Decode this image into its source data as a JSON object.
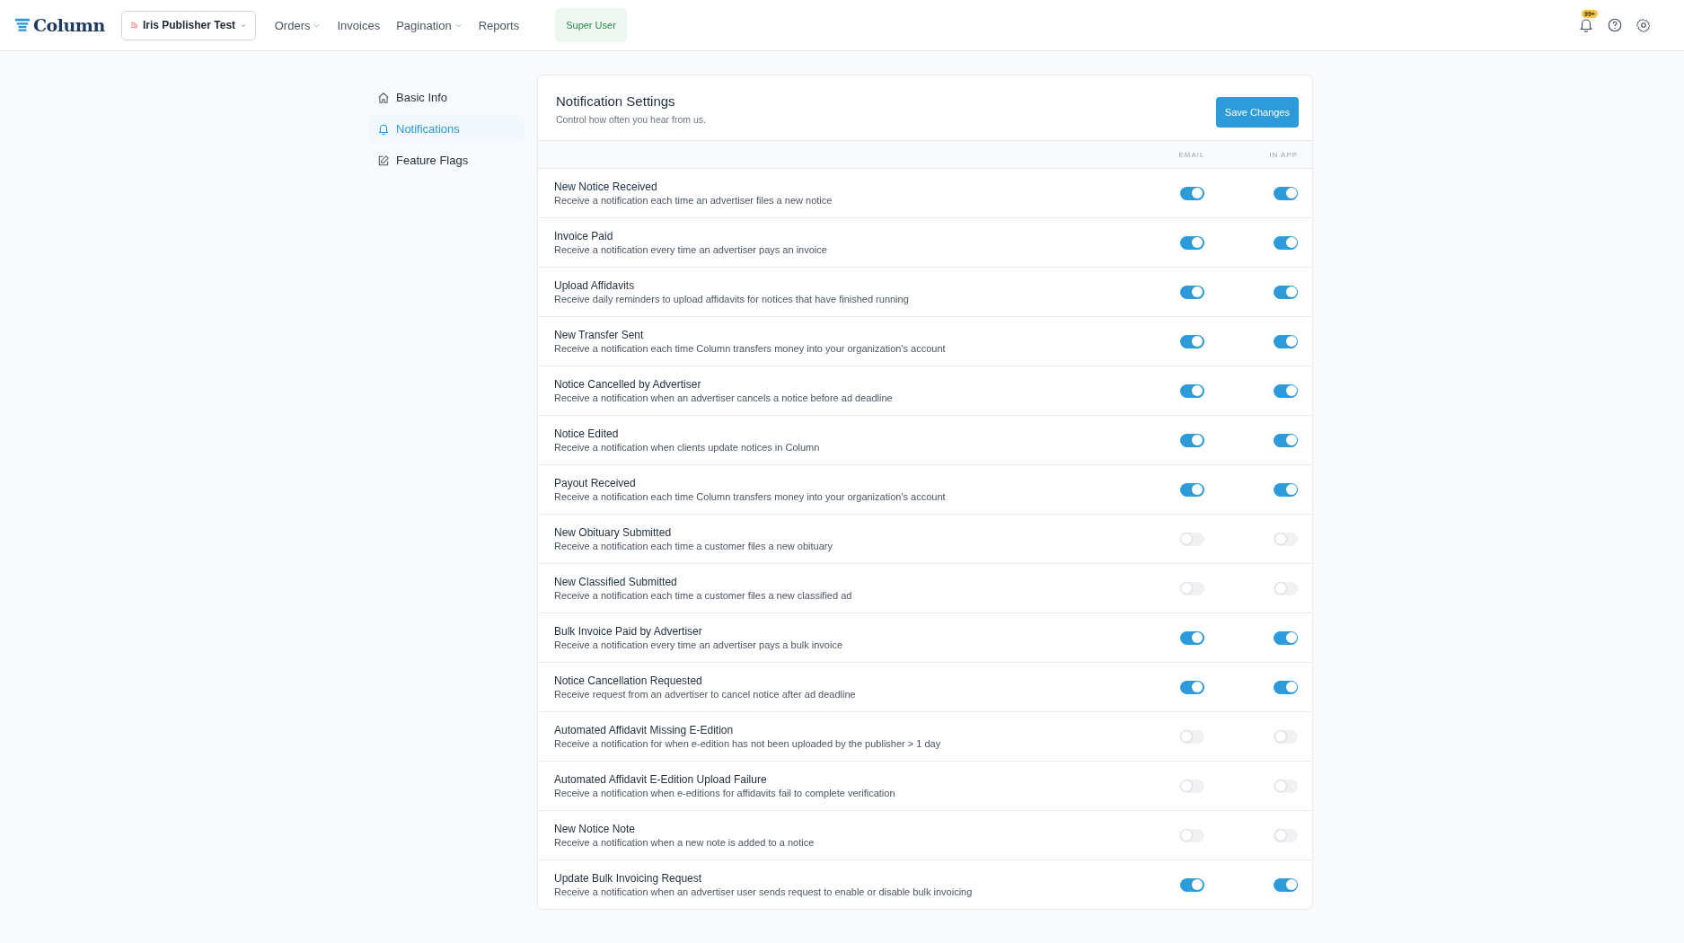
{
  "nav": {
    "logo": "Column",
    "publisher": "Iris Publisher Test",
    "menu": [
      {
        "label": "Orders",
        "dropdown": true
      },
      {
        "label": "Invoices",
        "dropdown": false
      },
      {
        "label": "Pagination",
        "dropdown": true
      },
      {
        "label": "Reports",
        "dropdown": false
      }
    ],
    "role_badge": "Super User",
    "notification_count": "99+"
  },
  "sidebar": {
    "items": [
      {
        "label": "Basic Info",
        "kind": "home",
        "selected": false
      },
      {
        "label": "Notifications",
        "kind": "bell",
        "selected": true
      },
      {
        "label": "Feature Flags",
        "kind": "edit",
        "selected": false
      }
    ]
  },
  "panel": {
    "title": "Notification Settings",
    "subtitle": "Control how often you hear from us.",
    "save_button": "Save Changes",
    "columns": [
      "EMAIL",
      "IN APP"
    ],
    "rows": [
      {
        "title": "New Notice Received",
        "description": "Receive a notification each time an advertiser files a new notice",
        "email": true,
        "in_app": true
      },
      {
        "title": "Invoice Paid",
        "description": "Receive a notification every time an advertiser pays an invoice",
        "email": true,
        "in_app": true
      },
      {
        "title": "Upload Affidavits",
        "description": "Receive daily reminders to upload affidavits for notices that have finished running",
        "email": true,
        "in_app": true
      },
      {
        "title": "New Transfer Sent",
        "description": "Receive a notification each time Column transfers money into your organization's account",
        "email": true,
        "in_app": true
      },
      {
        "title": "Notice Cancelled by Advertiser",
        "description": "Receive a notification when an advertiser cancels a notice before ad deadline",
        "email": true,
        "in_app": true
      },
      {
        "title": "Notice Edited",
        "description": "Receive a notification when clients update notices in Column",
        "email": true,
        "in_app": true
      },
      {
        "title": "Payout Received",
        "description": "Receive a notification each time Column transfers money into your organization's account",
        "email": true,
        "in_app": true
      },
      {
        "title": "New Obituary Submitted",
        "description": "Receive a notification each time a customer files a new obituary",
        "email": false,
        "in_app": false
      },
      {
        "title": "New Classified Submitted",
        "description": "Receive a notification each time a customer files a new classified ad",
        "email": false,
        "in_app": false
      },
      {
        "title": "Bulk Invoice Paid by Advertiser",
        "description": "Receive a notification every time an advertiser pays a bulk invoice",
        "email": true,
        "in_app": true
      },
      {
        "title": "Notice Cancellation Requested",
        "description": "Receive request from an advertiser to cancel notice after ad deadline",
        "email": true,
        "in_app": true
      },
      {
        "title": "Automated Affidavit Missing E-Edition",
        "description": "Receive a notification for when e-edition has not been uploaded by the publisher > 1 day",
        "email": false,
        "in_app": false
      },
      {
        "title": "Automated Affidavit E-Edition Upload Failure",
        "description": "Receive a notification when e-editions for affidavits fail to complete verification",
        "email": false,
        "in_app": false
      },
      {
        "title": "New Notice Note",
        "description": "Receive a notification when a new note is added to a notice",
        "email": false,
        "in_app": false
      },
      {
        "title": "Update Bulk Invoicing Request",
        "description": "Receive a notification when an advertiser user sends request to enable or disable bulk invoicing",
        "email": true,
        "in_app": true
      }
    ]
  }
}
